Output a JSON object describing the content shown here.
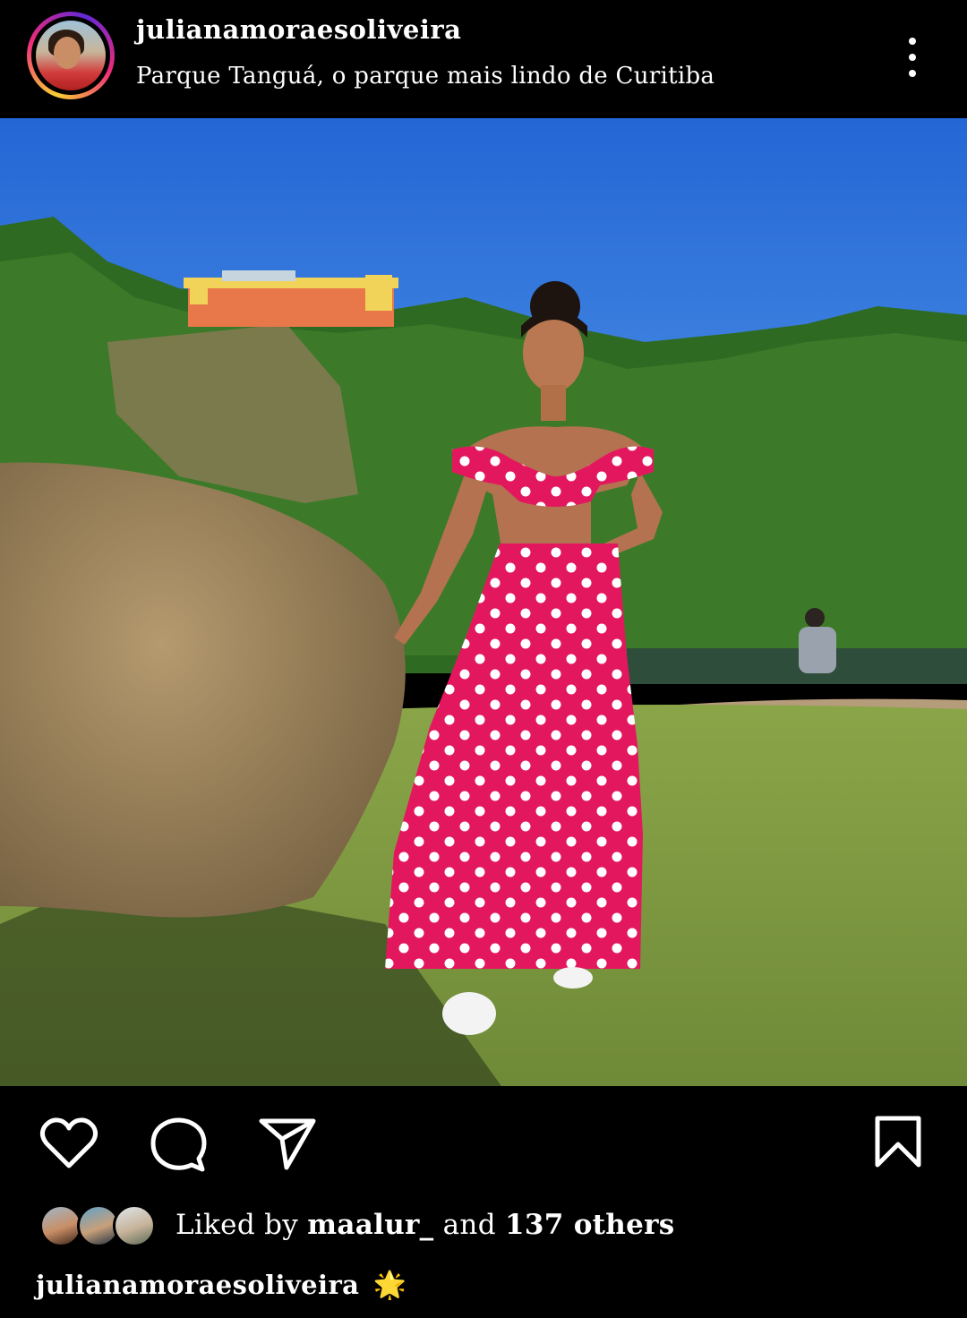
{
  "post": {
    "username": "julianamoraesoliveira",
    "location": "Parque Tanguá, o parque mais lindo de Curitiba",
    "more_icon": "more-vertical-icon"
  },
  "photo": {
    "alt": "Woman in pink polka dot crop top and tiered maxi skirt posing beside a large rock at a park with a yellow and orange lookout building on the cliff above"
  },
  "actions": {
    "icons": [
      "heart-icon",
      "comment-icon",
      "share-icon",
      "bookmark-icon"
    ]
  },
  "likes": {
    "prefix": "Liked by",
    "user": "maalur_",
    "connector": "and",
    "others": "137 others"
  },
  "caption": {
    "username": "julianamoraesoliveira",
    "emoji": "🌟"
  },
  "colors": {
    "background": "#000000",
    "text": "#ffffff",
    "sky": "#2b6fd6",
    "skirt": "#e3175e"
  }
}
